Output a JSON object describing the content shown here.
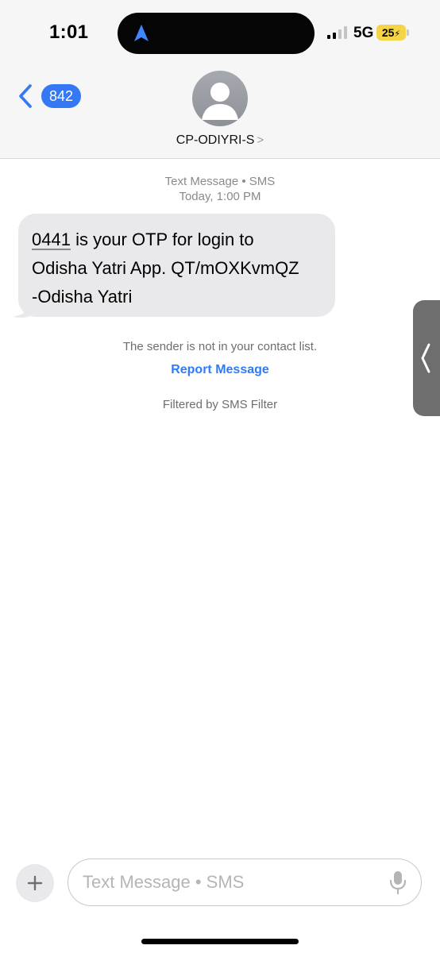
{
  "status_bar": {
    "time": "1:01",
    "network": "5G",
    "battery": "25"
  },
  "header": {
    "unread_count": "842",
    "contact_name": "CP-ODIYRI-S",
    "contact_chevron": ">"
  },
  "conversation": {
    "service_label": "Text Message • SMS",
    "timestamp": "Today, 1:00 PM",
    "message": {
      "otp": "0441",
      "line1_rest": " is your OTP for login to",
      "line2": "Odisha Yatri App. QT/mOXKvmQZ",
      "line3": "-Odisha Yatri"
    },
    "sender_notice": "The sender is not in your contact list.",
    "report_label": "Report Message",
    "filter_notice": "Filtered by SMS Filter"
  },
  "composer": {
    "placeholder": "Text Message • SMS"
  },
  "colors": {
    "accent": "#3478f6",
    "bubble": "#e9e9eb",
    "battery": "#f5d547"
  },
  "icons": [
    "location-arrow-icon",
    "signal-icon",
    "chevron-left-icon",
    "person-icon",
    "plus-icon",
    "microphone-icon"
  ]
}
